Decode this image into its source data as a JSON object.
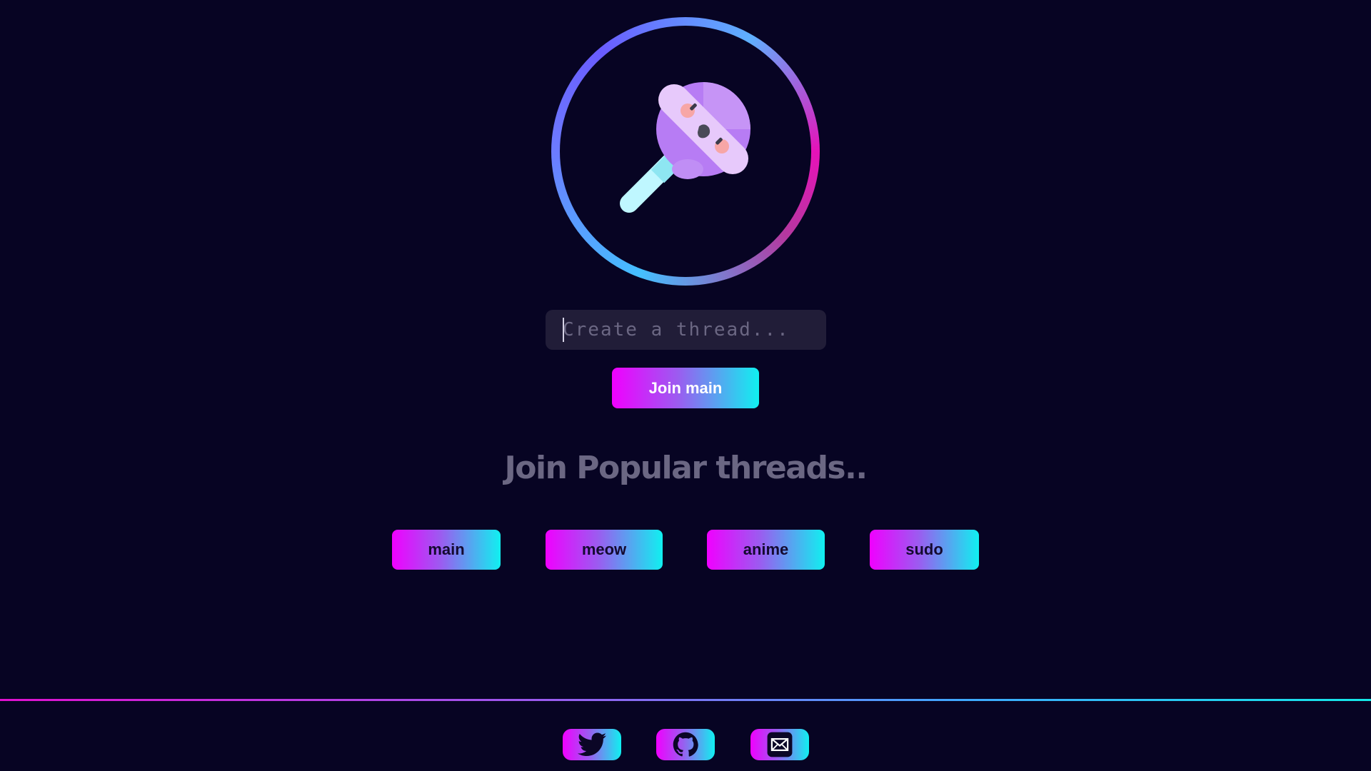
{
  "logo": {
    "icon": "lollipop-icon"
  },
  "thread_input": {
    "placeholder": "Create a thread...",
    "value": ""
  },
  "join_button": {
    "label": "Join main"
  },
  "popular": {
    "title": "Join Popular threads..",
    "threads": [
      {
        "label": "main"
      },
      {
        "label": "meow"
      },
      {
        "label": "anime"
      },
      {
        "label": "sudo"
      }
    ]
  },
  "footer": {
    "links": [
      {
        "icon": "twitter-icon"
      },
      {
        "icon": "github-icon"
      },
      {
        "icon": "mail-icon"
      }
    ]
  },
  "colors": {
    "background": "#070423",
    "gradient_start": "#f000ff",
    "gradient_end": "#10f0f0",
    "input_bg": "#211d38",
    "muted_text": "#6b6783"
  }
}
